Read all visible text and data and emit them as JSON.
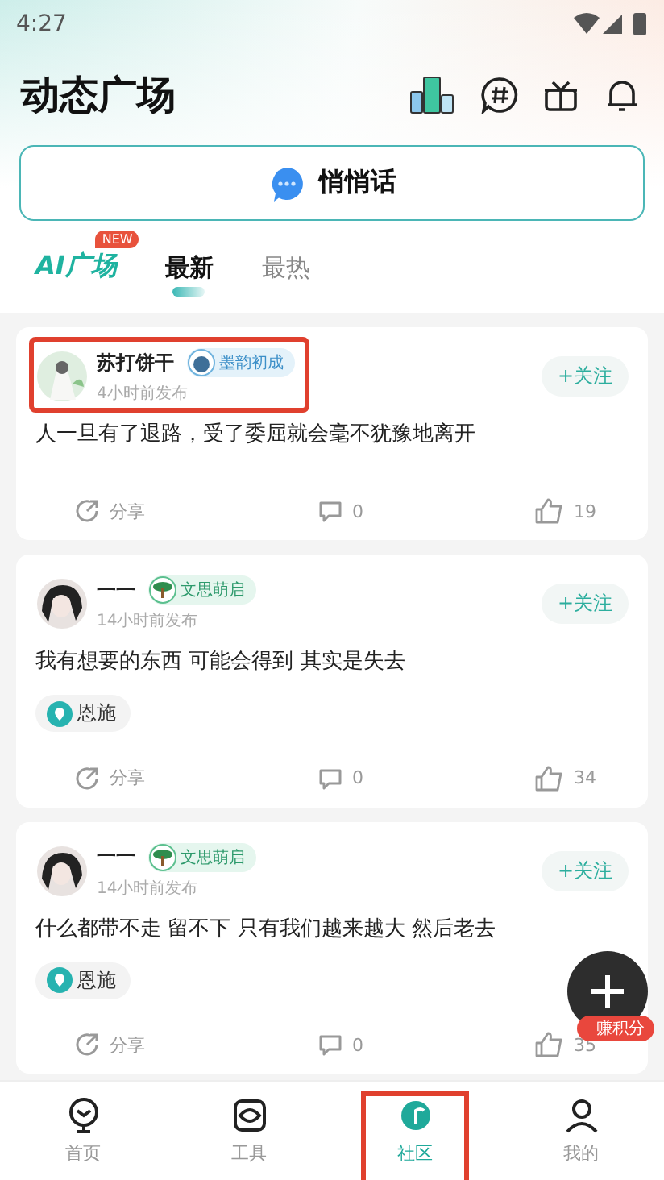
{
  "status_bar": {
    "time": "4:27"
  },
  "header": {
    "title": "动态广场"
  },
  "whisper_button": {
    "label": "悄悄话"
  },
  "tabs": [
    {
      "label": "AI广场",
      "kind": "ai",
      "badge": "NEW",
      "selected": false
    },
    {
      "label": "最新",
      "kind": "text",
      "selected": true
    },
    {
      "label": "最热",
      "kind": "text",
      "selected": false
    }
  ],
  "posts": [
    {
      "author": "苏打饼干",
      "badge": "墨韵初成",
      "kind": "ink",
      "time": "4小时前发布",
      "follow": "+关注",
      "text": "人一旦有了退路，受了委屈就会毫不犹豫地离开",
      "highlighted": true,
      "share": "分享",
      "comments": "0",
      "likes": "19"
    },
    {
      "author": "一一",
      "badge": "文思萌启",
      "kind": "tree",
      "time": "14小时前发布",
      "follow": "+关注",
      "text": "我有想要的东西 可能会得到 其实是失去",
      "location": "恩施",
      "highlighted": false,
      "share": "分享",
      "comments": "0",
      "likes": "34"
    },
    {
      "author": "一一",
      "badge": "文思萌启",
      "kind": "tree",
      "time": "14小时前发布",
      "follow": "+关注",
      "text": "什么都带不走 留不下 只有我们越来越大 然后老去",
      "location": "恩施",
      "highlighted": false,
      "share": "分享",
      "comments": "0",
      "likes": "35"
    }
  ],
  "fab": {
    "label": "赚积分"
  },
  "bottom_nav": [
    {
      "label": "首页",
      "selected": false,
      "highlighted": false
    },
    {
      "label": "工具",
      "selected": false,
      "highlighted": false
    },
    {
      "label": "社区",
      "selected": true,
      "highlighted": true
    },
    {
      "label": "我的",
      "selected": false,
      "highlighted": false
    }
  ]
}
